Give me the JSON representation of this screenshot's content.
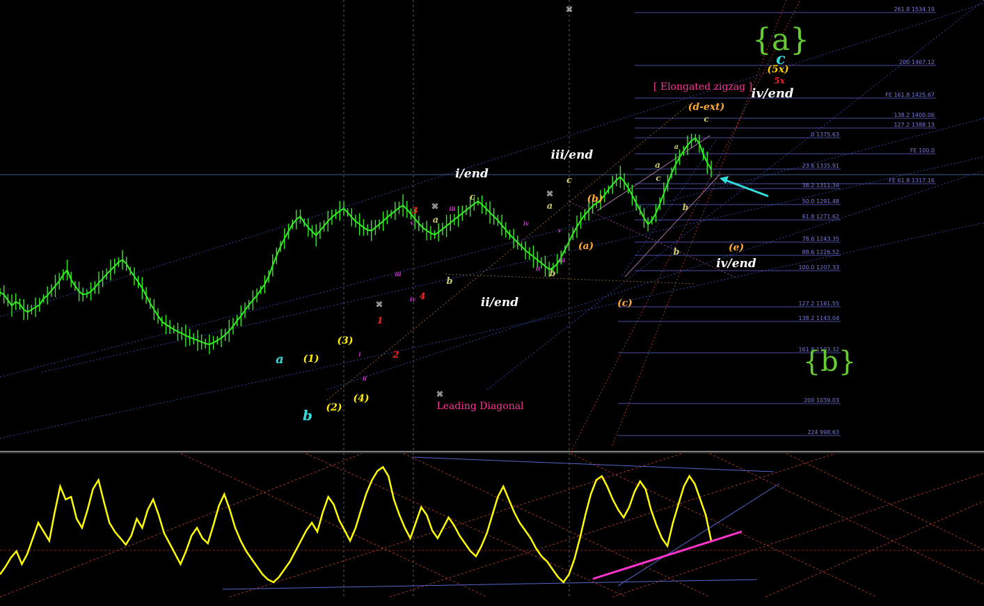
{
  "chart_data": {
    "type": "line",
    "main_series": {
      "y_values": [
        1180,
        1177,
        1170,
        1163,
        1168,
        1165,
        1158,
        1155,
        1158,
        1161,
        1164,
        1172,
        1176,
        1182,
        1188,
        1194,
        1202,
        1208,
        1196,
        1188,
        1181,
        1177,
        1178,
        1181,
        1186,
        1192,
        1197,
        1203,
        1208,
        1213,
        1218,
        1221,
        1216,
        1207,
        1200,
        1193,
        1185,
        1176,
        1166,
        1158,
        1150,
        1143,
        1139,
        1136,
        1133,
        1130,
        1128,
        1125,
        1123,
        1121,
        1119,
        1117,
        1115,
        1114,
        1116,
        1119,
        1122,
        1126,
        1131,
        1137,
        1144,
        1150,
        1157,
        1164,
        1170,
        1176,
        1183,
        1190,
        1200,
        1214,
        1226,
        1238,
        1248,
        1257,
        1266,
        1272,
        1276,
        1268,
        1262,
        1257,
        1252,
        1258,
        1264,
        1270,
        1275,
        1279,
        1283,
        1286,
        1281,
        1275,
        1270,
        1266,
        1262,
        1259,
        1258,
        1262,
        1266,
        1270,
        1275,
        1279,
        1283,
        1287,
        1290,
        1285,
        1279,
        1273,
        1267,
        1262,
        1258,
        1255,
        1253,
        1256,
        1260,
        1264,
        1268,
        1272,
        1276,
        1280,
        1284,
        1288,
        1292,
        1295,
        1291,
        1286,
        1281,
        1276,
        1271,
        1265,
        1259,
        1253,
        1248,
        1243,
        1238,
        1233,
        1229,
        1225,
        1221,
        1217,
        1213,
        1209,
        1211,
        1216,
        1224,
        1234,
        1244,
        1254,
        1263,
        1271,
        1278,
        1284,
        1289,
        1293,
        1297,
        1303,
        1310,
        1316,
        1322,
        1326,
        1320,
        1312,
        1303,
        1293,
        1284,
        1274,
        1266,
        1271,
        1280,
        1292,
        1305,
        1318,
        1331,
        1342,
        1351,
        1359,
        1366,
        1372,
        1375,
        1368,
        1355,
        1344,
        1336
      ],
      "labels_sample": [
        "a",
        "b",
        "(1)",
        "(2)",
        "(3)",
        "(4)",
        "(a)",
        "(b)",
        "(c)",
        "(d-ext)",
        "(e)",
        "(5x)",
        "5x",
        "1",
        "2",
        "3",
        "4",
        "i",
        "ii",
        "iii",
        "iv",
        "v",
        "c",
        "{a}",
        "{b}"
      ]
    },
    "fib_levels": [
      {
        "label": "261.8 1534.19",
        "price": 1534.19
      },
      {
        "label": "200 1467.12",
        "price": 1467.12
      },
      {
        "label": "FE 161.8 1425.67",
        "price": 1425.67
      },
      {
        "label": "138.2 1400.06",
        "price": 1400.06
      },
      {
        "label": "127.2 1388.13",
        "price": 1388.13
      },
      {
        "label": "0 1375.63",
        "price": 1375.63
      },
      {
        "label": "FE 100.0",
        "price": 1355.0
      },
      {
        "label": "23.6 1335.91",
        "price": 1335.91
      },
      {
        "label": "FE 61.8 1317.16",
        "price": 1317.16
      },
      {
        "label": "38.2 1311.34",
        "price": 1311.34
      },
      {
        "label": "50.0 1291.48",
        "price": 1291.48
      },
      {
        "label": "61.8 1271.62",
        "price": 1271.62
      },
      {
        "label": "78.6 1243.35",
        "price": 1243.35
      },
      {
        "label": "88.6 1226.52",
        "price": 1226.52
      },
      {
        "label": "100.0 1207.33",
        "price": 1207.33
      },
      {
        "label": "127.2 1161.55",
        "price": 1161.55
      },
      {
        "label": "138.2 1143.04",
        "price": 1143.04
      },
      {
        "label": "161.8 1103.32",
        "price": 1103.32
      },
      {
        "label": "200 1039.03",
        "price": 1039.03
      },
      {
        "label": "224 998.63",
        "price": 998.63
      }
    ],
    "wave_labels": [
      {
        "text": "{a}",
        "color": "#66cc33"
      },
      {
        "text": "c",
        "color": "#33dddd"
      },
      {
        "text": "(5x)",
        "color": "#ffcc00"
      },
      {
        "text": "5x",
        "color": "#ff2020"
      },
      {
        "text": "iv/end",
        "color": "#ffffff"
      },
      {
        "text": "[ Elongated zigzag ]",
        "color": "#ff3399"
      },
      {
        "text": "(d-ext)",
        "color": "#ffaa33"
      },
      {
        "text": "i/end",
        "color": "#ffffff"
      },
      {
        "text": "iii/end",
        "color": "#ffffff"
      },
      {
        "text": "ii/end",
        "color": "#ffffff"
      },
      {
        "text": "iv/end",
        "color": "#ffffff"
      },
      {
        "text": "(b)",
        "color": "#ffaa33"
      },
      {
        "text": "(a)",
        "color": "#ffaa33"
      },
      {
        "text": "(c)",
        "color": "#ffaa33"
      },
      {
        "text": "(e)",
        "color": "#ffaa33"
      },
      {
        "text": "a",
        "color": "#33dddd"
      },
      {
        "text": "b",
        "color": "#33dddd"
      },
      {
        "text": "(1)",
        "color": "#ffee00"
      },
      {
        "text": "(2)",
        "color": "#ffee00"
      },
      {
        "text": "(3)",
        "color": "#ffee00"
      },
      {
        "text": "(4)",
        "color": "#ffee00"
      },
      {
        "text": "1",
        "color": "#ff2020"
      },
      {
        "text": "2",
        "color": "#ff2020"
      },
      {
        "text": "3",
        "color": "#ff2020"
      },
      {
        "text": "4",
        "color": "#ff2020"
      },
      {
        "text": "Leading Diagonal",
        "color": "#ff3399"
      },
      {
        "text": "{b}",
        "color": "#66cc33"
      },
      {
        "text": "a",
        "color": "#cccc66"
      },
      {
        "text": "b",
        "color": "#cccc66"
      },
      {
        "text": "c",
        "color": "#cccc66"
      },
      {
        "text": "a",
        "color": "#cccc66"
      },
      {
        "text": "b",
        "color": "#cccc66"
      },
      {
        "text": "c",
        "color": "#cccc66"
      },
      {
        "text": "a",
        "color": "#cccc66"
      },
      {
        "text": "b",
        "color": "#cccc66"
      },
      {
        "text": "c",
        "color": "#cccc66"
      },
      {
        "text": "a",
        "color": "#cccc66"
      },
      {
        "text": "b",
        "color": "#cccc66"
      },
      {
        "text": "c",
        "color": "#cccc66"
      },
      {
        "text": "iii",
        "color": "#dd33dd"
      },
      {
        "text": "iv",
        "color": "#dd33dd"
      },
      {
        "text": "v",
        "color": "#dd33dd"
      },
      {
        "text": "i",
        "color": "#dd33dd"
      },
      {
        "text": "ii",
        "color": "#dd33dd"
      },
      {
        "text": "iii",
        "color": "#dd33dd"
      },
      {
        "text": "iv",
        "color": "#dd33dd"
      },
      {
        "text": "v",
        "color": "#dd33dd"
      },
      {
        "text": "iii",
        "color": "#dd33dd"
      },
      {
        "text": "ii",
        "color": "#dd33dd"
      },
      {
        "text": "iv",
        "color": "#dd33dd"
      }
    ],
    "oscillator": {
      "values": [
        12,
        18,
        25,
        30,
        20,
        28,
        40,
        52,
        45,
        38,
        60,
        80,
        70,
        72,
        55,
        48,
        62,
        78,
        85,
        68,
        52,
        45,
        40,
        35,
        42,
        55,
        48,
        62,
        70,
        58,
        44,
        36,
        28,
        20,
        30,
        42,
        48,
        40,
        36,
        50,
        65,
        74,
        62,
        48,
        38,
        30,
        24,
        18,
        12,
        8,
        6,
        10,
        16,
        22,
        30,
        38,
        46,
        52,
        45,
        60,
        72,
        66,
        54,
        46,
        38,
        48,
        62,
        75,
        85,
        92,
        95,
        88,
        70,
        58,
        48,
        40,
        52,
        64,
        58,
        46,
        40,
        48,
        56,
        50,
        42,
        36,
        30,
        26,
        34,
        44,
        58,
        72,
        80,
        70,
        60,
        52,
        46,
        40,
        32,
        26,
        22,
        16,
        10,
        6,
        12,
        24,
        40,
        58,
        74,
        85,
        88,
        80,
        70,
        62,
        56,
        64,
        76,
        84,
        78,
        62,
        50,
        40,
        34,
        52,
        66,
        80,
        88,
        82,
        70,
        58,
        38
      ],
      "colors": {
        "line": "#ffff00",
        "trend": "#ff33cc"
      }
    },
    "colors": {
      "background": "#000000",
      "candles": "#33ee22",
      "fib_lines": "#6666dd",
      "fib_text": "#7a7ae0",
      "channels": "#3355cc",
      "dotted_red": "#cc4422"
    }
  }
}
